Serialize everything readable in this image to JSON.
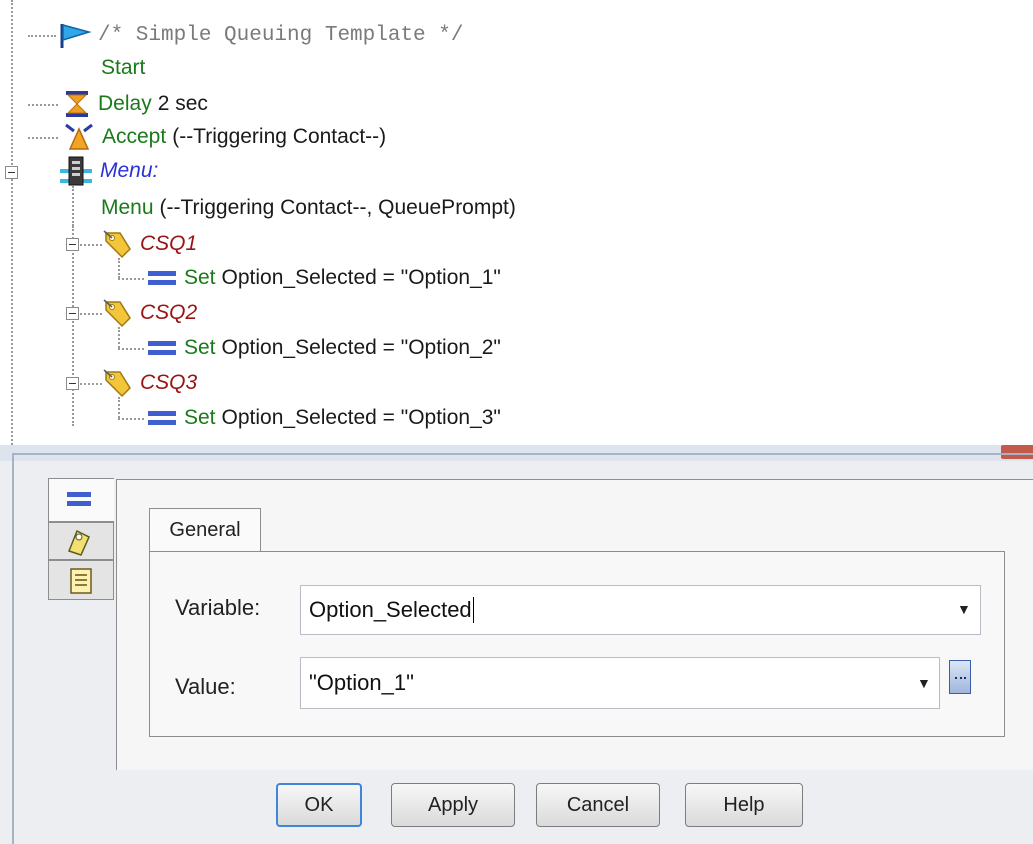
{
  "tree": {
    "comment": "/* Simple Queuing Template */",
    "start": "Start",
    "delay": {
      "keyword": "Delay",
      "arg": "2 sec"
    },
    "accept": {
      "keyword": "Accept",
      "arg": "(--Triggering Contact--)"
    },
    "menu_label": "Menu:",
    "menu_step": {
      "keyword": "Menu",
      "arg": "(--Triggering Contact--, QueuePrompt)"
    },
    "options": [
      {
        "label": "CSQ1",
        "keyword": "Set",
        "text": "Option_Selected = \"Option_1\""
      },
      {
        "label": "CSQ2",
        "keyword": "Set",
        "text": "Option_Selected = \"Option_2\""
      },
      {
        "label": "CSQ3",
        "keyword": "Set",
        "text": "Option_Selected = \"Option_3\""
      }
    ]
  },
  "dialog": {
    "tab_general": "General",
    "variable_label": "Variable:",
    "variable_value": "Option_Selected",
    "value_label": "Value:",
    "value_value": "\"Option_1\"",
    "buttons": {
      "ok": "OK",
      "apply": "Apply",
      "cancel": "Cancel",
      "help": "Help"
    }
  },
  "icons": {
    "start": "flag-icon",
    "delay": "hourglass-icon",
    "accept": "accept-icon",
    "menu": "menu-icon",
    "label": "label-tag-icon",
    "set": "set-equals-icon"
  },
  "colors": {
    "keyword_green": "#1a7a1a",
    "menu_label_blue": "#2a32d8",
    "case_label_red": "#9a1414",
    "comment_gray": "#7a7a7a",
    "focus_blue": "#3f86d8"
  }
}
